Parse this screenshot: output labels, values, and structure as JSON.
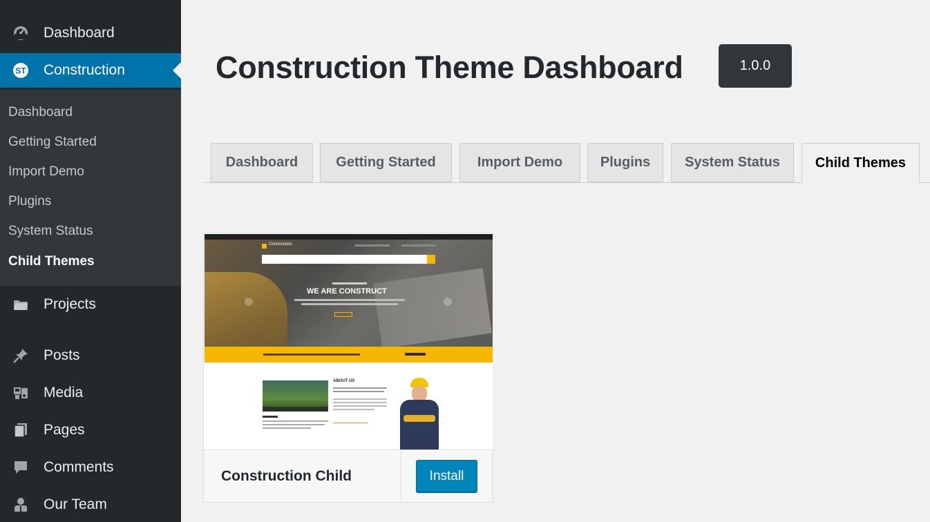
{
  "sidebar": {
    "menu": [
      {
        "label": "Dashboard",
        "icon": "dashboard-icon"
      },
      {
        "label": "Construction",
        "icon": "construction-logo-icon",
        "current": true
      },
      {
        "label": "Projects",
        "icon": "folder-icon"
      },
      {
        "label": "Posts",
        "icon": "pin-icon"
      },
      {
        "label": "Media",
        "icon": "media-icon"
      },
      {
        "label": "Pages",
        "icon": "pages-icon"
      },
      {
        "label": "Comments",
        "icon": "comment-icon"
      },
      {
        "label": "Our Team",
        "icon": "team-icon"
      }
    ],
    "construction_logo_text": "ST",
    "submenu": [
      "Dashboard",
      "Getting Started",
      "Import Demo",
      "Plugins",
      "System Status",
      "Child Themes"
    ],
    "submenu_active": "Child Themes"
  },
  "header": {
    "title": "Construction Theme Dashboard",
    "version": "1.0.0"
  },
  "tabs": [
    {
      "label": "Dashboard"
    },
    {
      "label": "Getting Started"
    },
    {
      "label": "Import Demo"
    },
    {
      "label": "Plugins"
    },
    {
      "label": "System Status"
    },
    {
      "label": "Child Themes",
      "active": true
    }
  ],
  "theme_card": {
    "name": "Construction Child",
    "install_label": "Install",
    "screenshot": {
      "brand": "Construction",
      "hero_title": "WE ARE CONSTRUCT",
      "about_title": "ABOUT US"
    }
  },
  "colors": {
    "admin_bar": "#23282d",
    "submenu_bg": "#32373c",
    "accent": "#0073aa",
    "button": "#0085ba",
    "preview_yellow": "#f5b700"
  }
}
